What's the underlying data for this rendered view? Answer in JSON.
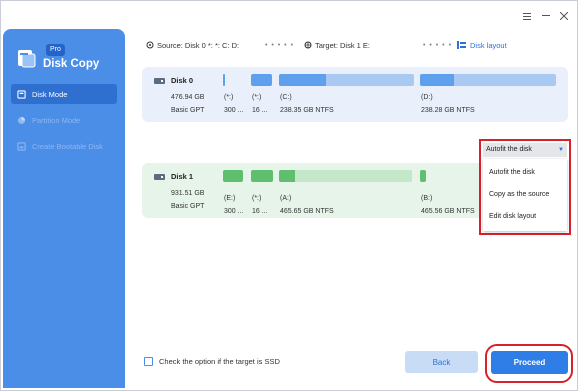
{
  "app": {
    "title": "Disk Copy",
    "badge": "Pro"
  },
  "sidebar": {
    "items": [
      {
        "label": "Disk Mode",
        "icon": "disk-icon",
        "active": true
      },
      {
        "label": "Partition Mode",
        "icon": "pie-icon",
        "active": false
      },
      {
        "label": "Create Bootable Disk",
        "icon": "bootable-disk-icon",
        "active": false
      }
    ]
  },
  "window": {
    "menu_icon": "hamburger-icon",
    "minimize_icon": "minimize-icon",
    "close_icon": "close-icon"
  },
  "header": {
    "source": "Source: Disk 0 *: *: C: D:",
    "target": "Target: Disk 1 E:",
    "disk_layout": "Disk layout"
  },
  "disk0": {
    "name": "Disk 0",
    "size": "476.94 GB",
    "type": "Basic GPT",
    "partitions": [
      {
        "letter": "(*:)",
        "size": "300 ..."
      },
      {
        "letter": "(*:)",
        "size": "16 ..."
      },
      {
        "letter": "(C:)",
        "size": "238.35 GB NTFS"
      },
      {
        "letter": "(D:)",
        "size": "238.28 GB NTFS"
      }
    ]
  },
  "disk1": {
    "name": "Disk 1",
    "size": "931.51 GB",
    "type": "Basic GPT",
    "partitions": [
      {
        "letter": "(E:)",
        "size": "300 ..."
      },
      {
        "letter": "(*:)",
        "size": "16 ..."
      },
      {
        "letter": "(A:)",
        "size": "465.65 GB NTFS"
      },
      {
        "letter": "(B:)",
        "size": "465.56 GB NTFS"
      }
    ]
  },
  "layout_dropdown": {
    "selected": "Autofit the disk",
    "options": [
      "Autofit the disk",
      "Copy as the source",
      "Edit disk layout"
    ]
  },
  "footer": {
    "ssd_label": "Check the option if the target is SSD",
    "back": "Back",
    "proceed": "Proceed"
  },
  "colors": {
    "accent": "#2f7de6",
    "sidebar": "#4a8ee8",
    "highlight": "#d7212b",
    "disk0_bar": "#5fa0ec",
    "disk1_bar": "#5fbf6e"
  }
}
